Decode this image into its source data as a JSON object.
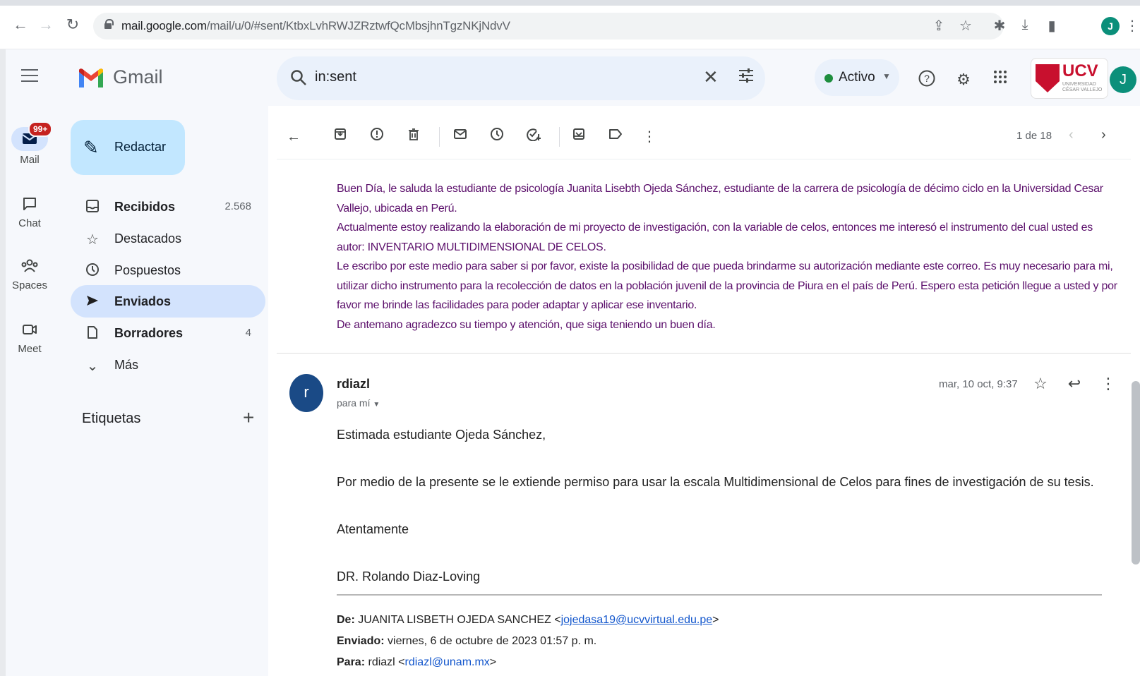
{
  "browser": {
    "url_host": "mail.google.com",
    "url_path": "/mail/u/0/#sent/KtbxLvhRWJZRztwfQcMbsjhnTgzNKjNdvV",
    "profile_initial": "J"
  },
  "rail": {
    "mail_label": "Mail",
    "mail_badge": "99+",
    "chat_label": "Chat",
    "spaces_label": "Spaces",
    "meet_label": "Meet"
  },
  "header": {
    "app_name": "Gmail",
    "search_query": "in:sent",
    "status_label": "Activo",
    "org_name": "UCV",
    "org_sub": "UNIVERSIDAD CÉSAR VALLEJO",
    "avatar_initial": "J"
  },
  "sidebar": {
    "compose_label": "Redactar",
    "items": [
      {
        "label": "Recibidos",
        "count": "2.568",
        "icon": "inbox-icon",
        "bold": true
      },
      {
        "label": "Destacados",
        "count": "",
        "icon": "star-icon",
        "bold": false
      },
      {
        "label": "Pospuestos",
        "count": "",
        "icon": "clock-icon",
        "bold": false
      },
      {
        "label": "Enviados",
        "count": "",
        "icon": "send-icon",
        "bold": true
      },
      {
        "label": "Borradores",
        "count": "4",
        "icon": "draft-icon",
        "bold": true
      },
      {
        "label": "Más",
        "count": "",
        "icon": "chevron-down-icon",
        "bold": false
      }
    ],
    "labels_title": "Etiquetas"
  },
  "toolbar": {
    "pager": "1 de 18"
  },
  "quoted_message": {
    "paragraphs": [
      "Buen Día, le saluda la estudiante de psicología Juanita Lisebth Ojeda Sánchez, estudiante de la carrera de psicología de décimo ciclo en la Universidad Cesar Vallejo, ubicada en Perú.",
      "Actualmente estoy realizando la elaboración de mi proyecto de investigación, con la variable de celos, entonces me interesó el instrumento del cual usted es autor: INVENTARIO MULTIDIMENSIONAL DE CELOS.",
      "Le escribo por este medio para saber si por favor, existe la posibilidad de que pueda brindarme su autorización mediante este correo. Es muy necesario para mi, utilizar dicho instrumento para la recolección de datos en la población juvenil de la provincia de Piura en el país de Perú. Espero esta petición llegue a usted y por favor me brinde las facilidades para poder adaptar y aplicar ese inventario.",
      "De antemano agradezco su tiempo y atención, que siga teniendo un buen día."
    ]
  },
  "reply": {
    "avatar_initial": "r",
    "sender": "rdiazl",
    "to_line": "para mí",
    "date": "mar, 10 oct, 9:37",
    "greeting": "Estimada estudiante Ojeda Sánchez,",
    "body": "Por medio de la presente se le extiende permiso para usar la escala Multidimensional de Celos para fines de investigación de su tesis.",
    "closing": "Atentamente",
    "signature": "DR. Rolando Diaz-Loving",
    "from_label": "De:",
    "from_name": "JUANITA LISBETH OJEDA SANCHEZ <",
    "from_email": "jojedasa19@ucvvirtual.edu.pe",
    "from_end": ">",
    "sent_label": "Enviado:",
    "sent_value": "viernes, 6 de octubre de 2023 01:57 p. m.",
    "to_label": "Para:",
    "to_name": "rdiazl <",
    "to_email": "rdiazl@unam.mx",
    "to_end": ">"
  },
  "colors": {
    "quoted_text": "#5b0f6b",
    "compose_bg": "#c2e7ff",
    "active_nav": "#d3e3fd",
    "badge": "#c5221f",
    "status_dot": "#1e8e3e"
  }
}
